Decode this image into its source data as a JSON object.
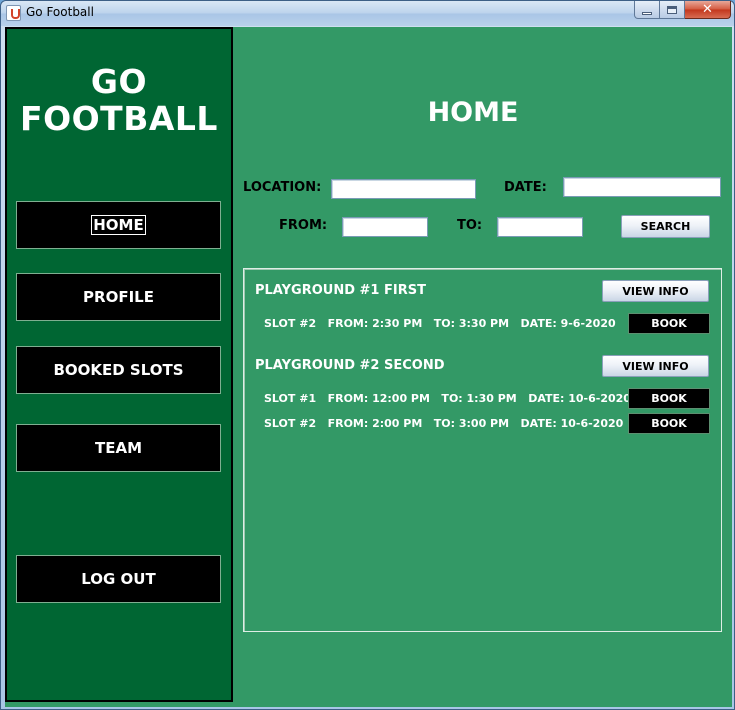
{
  "window": {
    "title": "Go Football",
    "controls": {
      "minimize_icon": "minimize-icon",
      "maximize_icon": "maximize-icon",
      "close_icon": "close-icon"
    }
  },
  "colors": {
    "sidebar_bg": "#006633",
    "main_bg": "#339966",
    "nav_button_bg": "#000000",
    "text_light": "#FFFFFF"
  },
  "sidebar": {
    "brand_line1": "GO",
    "brand_line2": "FOOTBALL",
    "items": [
      {
        "label": "HOME",
        "active": true
      },
      {
        "label": "PROFILE"
      },
      {
        "label": "BOOKED SLOTS"
      },
      {
        "label": "TEAM"
      },
      {
        "label": "LOG OUT"
      }
    ]
  },
  "main": {
    "title": "HOME",
    "search": {
      "location_label": "LOCATION:",
      "location_value": "",
      "date_label": "DATE:",
      "date_value": "",
      "from_label": "FROM:",
      "from_value": "",
      "to_label": "TO:",
      "to_value": "",
      "search_button": "SEARCH"
    },
    "playgrounds": [
      {
        "name": "PLAYGROUND #1 FIRST",
        "view_info": "VIEW INFO",
        "slots": [
          {
            "text": "SLOT #2   FROM: 2:30 PM   TO: 3:30 PM   DATE: 9-6-2020",
            "book": "BOOK"
          }
        ]
      },
      {
        "name": "PLAYGROUND #2 SECOND",
        "view_info": "VIEW INFO",
        "slots": [
          {
            "text": "SLOT #1   FROM: 12:00 PM   TO: 1:30 PM   DATE: 10-6-2020",
            "book": "BOOK"
          },
          {
            "text": "SLOT #2   FROM: 2:00 PM   TO: 3:00 PM   DATE: 10-6-2020",
            "book": "BOOK"
          }
        ]
      }
    ]
  }
}
